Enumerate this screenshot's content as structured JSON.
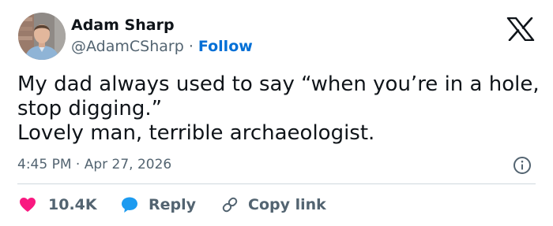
{
  "author": {
    "name": "Adam Sharp",
    "handle": "@AdamCSharp",
    "separator": "·",
    "follow_label": "Follow"
  },
  "tweet": {
    "lines": [
      "My dad always used to say “when you’re in a hole,",
      "stop digging.”",
      "Lovely man, terrible archaeologist."
    ],
    "timestamp": "4:45 PM · Apr 27, 2026"
  },
  "actions": {
    "like": {
      "count": "10.4K",
      "icon": "heart-icon"
    },
    "reply": {
      "label": "Reply",
      "icon": "speech-bubble-icon"
    },
    "copy_link": {
      "label": "Copy link",
      "icon": "link-icon"
    }
  },
  "icons": {
    "brand": "x-logo-icon",
    "info": "info-icon"
  },
  "colors": {
    "text": "#0f1419",
    "secondary": "#536471",
    "follow": "#006fd6",
    "like": "#f91880",
    "reply": "#1d9bf0",
    "divider": "#cfd9de"
  }
}
